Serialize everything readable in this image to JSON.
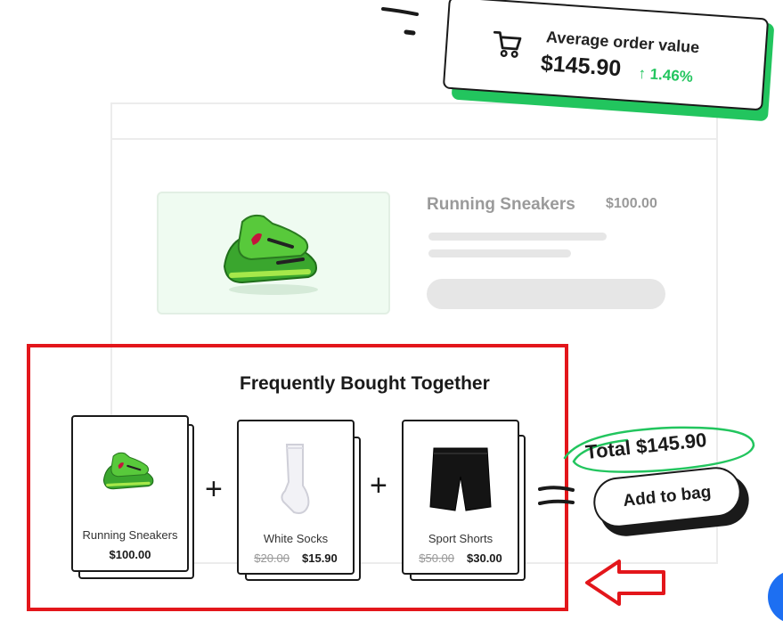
{
  "stat_card": {
    "title": "Average order value",
    "value": "$145.90",
    "change": "1.46%",
    "change_color": "#22c55e",
    "icon": "cart-icon"
  },
  "product": {
    "name": "Running Sneakers",
    "price": "$100.00"
  },
  "fbt": {
    "title": "Frequently Bought Together",
    "items": [
      {
        "name": "Running Sneakers",
        "price": "$100.00",
        "old_price": "",
        "icon": "sneaker-image"
      },
      {
        "name": "White Socks",
        "price": "$15.90",
        "old_price": "$20.00",
        "icon": "sock-image"
      },
      {
        "name": "Sport Shorts",
        "price": "$30.00",
        "old_price": "$50.00",
        "icon": "shorts-image"
      }
    ],
    "operator_plus": "+",
    "total_label": "Total",
    "total_value": "$145.90",
    "add_to_bag_label": "Add to bag"
  },
  "colors": {
    "accent": "#22c55e",
    "highlight": "#e3161b",
    "ink": "#1a1a1a"
  }
}
